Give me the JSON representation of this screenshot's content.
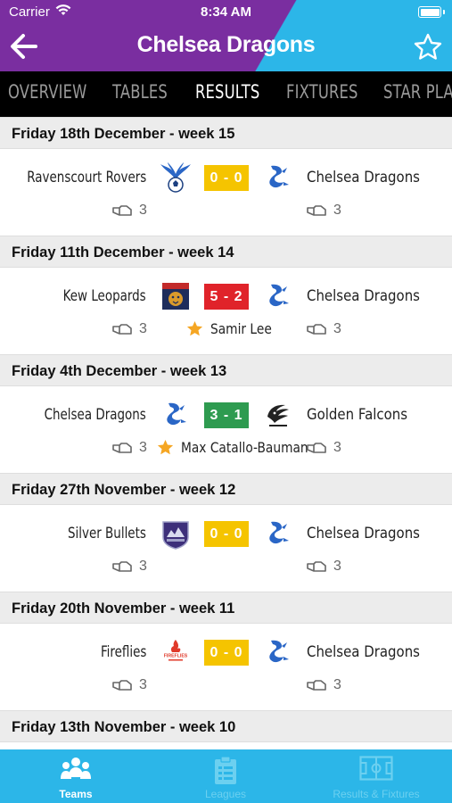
{
  "status_bar": {
    "carrier": "Carrier",
    "time": "8:34 AM"
  },
  "header": {
    "title": "Chelsea Dragons",
    "back_icon": "back-arrow-icon",
    "favorite_icon": "star-outline-icon"
  },
  "tabs": [
    {
      "label": "OVERVIEW",
      "active": false
    },
    {
      "label": "TABLES",
      "active": false
    },
    {
      "label": "RESULTS",
      "active": true
    },
    {
      "label": "FIXTURES",
      "active": false
    },
    {
      "label": "STAR PLA",
      "active": false
    }
  ],
  "colors": {
    "purple": "#7a2ea0",
    "cyan": "#2cb6e8",
    "draw": "#f5c400",
    "loss": "#e0232a",
    "win": "#2e9b50",
    "star": "#f5a623"
  },
  "results": [
    {
      "date": "Friday 18th December - week 15",
      "home": "Ravenscourt Rovers",
      "home_crest": "ravenscourt-rovers-crest",
      "away": "Chelsea Dragons",
      "away_crest": "chelsea-dragons-crest",
      "score": "0 - 0",
      "result": "draw",
      "home_votes": "3",
      "away_votes": "3",
      "star_player": ""
    },
    {
      "date": "Friday 11th December - week 14",
      "home": "Kew Leopards",
      "home_crest": "kew-leopards-crest",
      "away": "Chelsea Dragons",
      "away_crest": "chelsea-dragons-crest",
      "score": "5 - 2",
      "result": "loss",
      "home_votes": "3",
      "away_votes": "3",
      "star_player": "Samir Lee"
    },
    {
      "date": "Friday 4th December - week 13",
      "home": "Chelsea Dragons",
      "home_crest": "chelsea-dragons-crest",
      "away": "Golden Falcons",
      "away_crest": "golden-falcons-crest",
      "score": "3 - 1",
      "result": "win",
      "home_votes": "3",
      "away_votes": "3",
      "star_player": "Max Catallo-Bauman"
    },
    {
      "date": "Friday 27th November - week 12",
      "home": "Silver Bullets",
      "home_crest": "silver-bullets-crest",
      "away": "Chelsea Dragons",
      "away_crest": "chelsea-dragons-crest",
      "score": "0 - 0",
      "result": "draw",
      "home_votes": "3",
      "away_votes": "3",
      "star_player": ""
    },
    {
      "date": "Friday 20th November - week 11",
      "home": "Fireflies",
      "home_crest": "fireflies-crest",
      "away": "Chelsea Dragons",
      "away_crest": "chelsea-dragons-crest",
      "score": "0 - 0",
      "result": "draw",
      "home_votes": "3",
      "away_votes": "3",
      "star_player": ""
    },
    {
      "date": "Friday 13th November - week 10"
    }
  ],
  "bottom_nav": [
    {
      "label": "Teams",
      "icon": "teams-icon",
      "active": true
    },
    {
      "label": "Leagues",
      "icon": "leagues-icon",
      "active": false
    },
    {
      "label": "Results & Fixtures",
      "icon": "pitch-icon",
      "active": false
    }
  ]
}
